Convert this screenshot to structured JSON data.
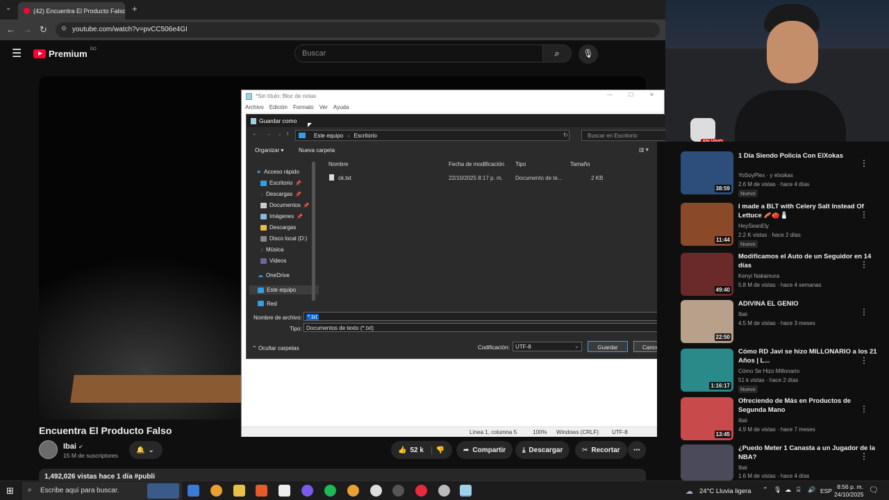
{
  "browser": {
    "tab_title": "(42) Encuentra El Producto Falso",
    "url": "youtube.com/watch?v=pvCC506e4GI"
  },
  "yt": {
    "logo_text": "Premium",
    "country": "DO",
    "search_placeholder": "Buscar"
  },
  "video": {
    "title": "Encuentra El Producto Falso",
    "channel": "Ibai",
    "subscribers": "15 M de suscriptores",
    "likes": "52 k",
    "share": "Compartir",
    "download": "Descargar",
    "clip": "Recortar",
    "views_line": "1,492,026 vistas  hace 1 día  #publi"
  },
  "notepad": {
    "title": "*Sin título: Bloc de notas",
    "menu": [
      "Archivo",
      "Edición",
      "Formato",
      "Ver",
      "Ayuda"
    ],
    "status": {
      "position": "Línea 1, columna 5",
      "zoom": "100%",
      "eol": "Windows (CRLF)",
      "encoding": "UTF-8"
    }
  },
  "save_dialog": {
    "title": "Guardar como",
    "path": [
      "Este equipo",
      "Escritorio"
    ],
    "search_placeholder": "Buscar en Escritorio",
    "organize": "Organizar",
    "new_folder": "Nueva carpeta",
    "tree": [
      "Acceso rápido",
      "Escritorio",
      "Descargas",
      "Documentos",
      "Imágenes",
      "Descargas",
      "Disco local (D:)",
      "Música",
      "Videos",
      "OneDrive",
      "Este equipo",
      "Red"
    ],
    "columns": [
      "Nombre",
      "Fecha de modificación",
      "Tipo",
      "Tamaño"
    ],
    "files": [
      {
        "name": "ck.txt",
        "modified": "22/10/2025 8:17 p. m.",
        "type": "Documento de te...",
        "size": "2 KB"
      }
    ],
    "filename_label": "Nombre de archivo:",
    "filename_value": "*.txt",
    "type_label": "Tipo:",
    "type_value": "Documentos de texto (*.txt)",
    "hide_folders": "Ocultar carpetas",
    "encoding_label": "Codificación:",
    "encoding_value": "UTF-8",
    "save": "Guardar",
    "cancel": "Cancelar"
  },
  "live_badge": "EN VIVO",
  "recommendations": [
    {
      "title": "1 Día Siendo Policía Con ElXokas",
      "channel": "YoSoyPlex · y elxokas",
      "meta": "2.6 M de vistas · hace 4 días",
      "duration": "38:59",
      "badge": "Nuevo",
      "color": "#2d4d7a"
    },
    {
      "title": "I made a BLT with Celery Salt Instead Of Lettuce 🥓🍅🧂",
      "channel": "HeySeanEly",
      "meta": "2.2 K vistas · hace 2 días",
      "duration": "11:44",
      "badge": "Nuevo",
      "color": "#8a4a2a"
    },
    {
      "title": "Modificamos el Auto de un Seguidor en 14 días",
      "channel": "Kenyi Nakamura",
      "meta": "5.8 M de vistas · hace 4 semanas",
      "duration": "49:40",
      "badge": "",
      "color": "#6a2a2a"
    },
    {
      "title": "ADIVINA EL GENIO",
      "channel": "Ibai",
      "meta": "4.5 M de vistas · hace 3 meses",
      "duration": "22:50",
      "badge": "",
      "color": "#b8a08a"
    },
    {
      "title": "Cómo RD Javi se hizo MILLONARIO a los 21 Años | L...",
      "channel": "Cómo Se Hizo Millonario",
      "meta": "51 k vistas · hace 2 días",
      "duration": "1:16:17",
      "badge": "Nuevo",
      "color": "#2a8a8a"
    },
    {
      "title": "Ofreciendo de Más en Productos de Segunda Mano",
      "channel": "Ibai",
      "meta": "4.9 M de vistas · hace 7 meses",
      "duration": "13:45",
      "badge": "",
      "color": "#c84a4a"
    },
    {
      "title": "¿Puedo Meter 1 Canasta a un Jugador de la NBA?",
      "channel": "Ibai",
      "meta": "1.6 M de vistas · hace 4 días",
      "duration": "",
      "badge": "",
      "color": "#4a4a5a"
    }
  ],
  "taskbar": {
    "search": "Escribe aquí para buscar.",
    "weather": "24°C  Lluvia ligera",
    "lang": "ESP",
    "time": "8:56 p. m.",
    "date": "24/10/2025"
  }
}
